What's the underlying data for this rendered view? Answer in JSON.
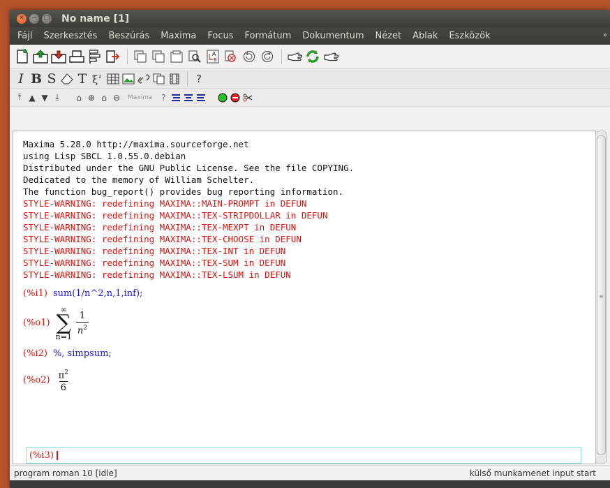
{
  "window": {
    "title": "No name [1]"
  },
  "menubar": {
    "items": [
      "Fájl",
      "Szerkesztés",
      "Beszúrás",
      "Maxima",
      "Focus",
      "Formátum",
      "Dokumentum",
      "Nézet",
      "Ablak",
      "Eszközök"
    ],
    "more": "»"
  },
  "toolbar2": {
    "italic": "I",
    "bold": "B",
    "slanted": "S",
    "text": "T",
    "help": "?"
  },
  "toolbar3": {
    "maxima_label": "Maxima",
    "help": "?"
  },
  "document": {
    "banner": [
      "Maxima 5.28.0 http://maxima.sourceforge.net",
      "using Lisp SBCL 1.0.55.0.debian",
      "Distributed under the GNU Public License. See the file COPYING.",
      "Dedicated to the memory of William Schelter.",
      "The function bug_report() provides bug reporting information."
    ],
    "warnings": [
      "STYLE-WARNING: redefining MAXIMA::MAIN-PROMPT in DEFUN",
      "STYLE-WARNING: redefining MAXIMA::TEX-STRIPDOLLAR in DEFUN",
      "STYLE-WARNING: redefining MAXIMA::TEX-MEXPT in DEFUN",
      "STYLE-WARNING: redefining MAXIMA::TEX-CHOOSE in DEFUN",
      "STYLE-WARNING: redefining MAXIMA::TEX-INT in DEFUN",
      "STYLE-WARNING: redefining MAXIMA::TEX-SUM in DEFUN",
      "STYLE-WARNING: redefining MAXIMA::TEX-LSUM in DEFUN"
    ],
    "i1": {
      "label": "(%i1)",
      "input": "sum(1/n^2,n,1,inf);"
    },
    "o1": {
      "label": "(%o1)",
      "sup": "∞",
      "sub": "n=1",
      "num": "1",
      "den": "n",
      "den_exp": "2"
    },
    "i2": {
      "label": "(%i2)",
      "input": "%, simpsum;"
    },
    "o2": {
      "label": "(%o2)",
      "num": "π",
      "num_exp": "2",
      "den": "6"
    },
    "i3": {
      "label": "(%i3)",
      "input": ""
    }
  },
  "statusbar": {
    "left": "program roman 10 [idle]",
    "right": "külső munkamenet input start"
  },
  "colors": {
    "warning": "#e0120c",
    "input": "#1515ee",
    "active_cell_border": "#7fe0e8",
    "titlebar": "#3c3b37",
    "close_button": "#e25b1f"
  }
}
